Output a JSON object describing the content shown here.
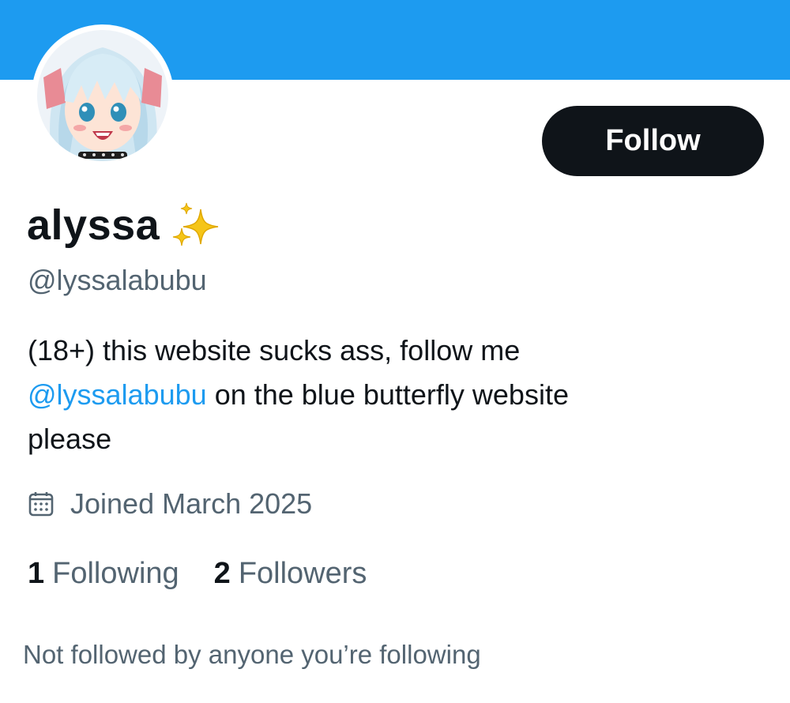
{
  "profile": {
    "display_name": "alyssa",
    "display_name_emoji": "sparkles-icon",
    "handle": "@lyssalabubu",
    "bio": {
      "part1": "(18+) this website sucks ass, follow me",
      "mention": "@lyssalabubu",
      "part2": "on the blue butterfly website",
      "part3": "please"
    },
    "joined": "Joined March 2025",
    "following_count": "1",
    "following_label": "Following",
    "followers_count": "2",
    "followers_label": "Followers",
    "followed_by_text": "Not followed by anyone you’re following"
  },
  "actions": {
    "follow_label": "Follow"
  },
  "colors": {
    "banner": "#1d9bf0",
    "link": "#1d9bf0",
    "button_bg": "#0f1419",
    "secondary_text": "#536471"
  }
}
